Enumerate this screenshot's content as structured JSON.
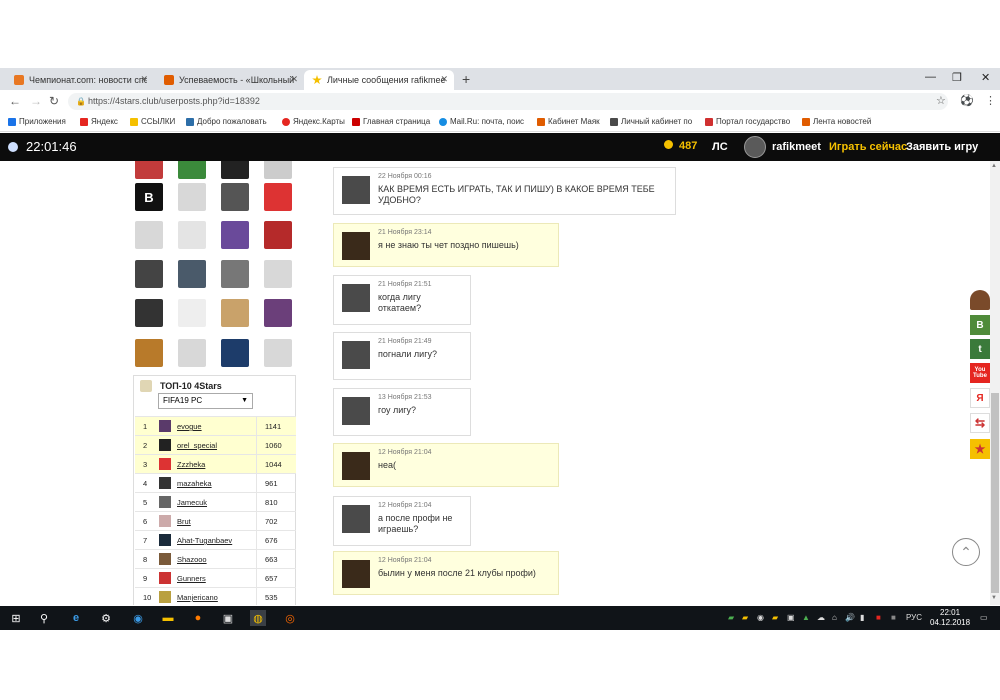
{
  "browser": {
    "tabs": [
      {
        "title": "Чемпионат.com: новости спорт",
        "favicon_color": "#e87722"
      },
      {
        "title": "Успеваемость - «Школьный по",
        "favicon_color": "#e05c00"
      },
      {
        "title": "Личные сообщения rafikmeet. -",
        "favicon_color": "#f5c000"
      }
    ],
    "new_tab": "+",
    "url": "https://4stars.club/userposts.php?id=18392",
    "bookmarks": [
      {
        "label": "Приложения",
        "color": "#1a73e8"
      },
      {
        "label": "Яндекс",
        "color": "#e52620"
      },
      {
        "label": "ССЫЛКИ",
        "color": "#f5c000"
      },
      {
        "label": "Добро пожаловать",
        "color": "#2d6ea8"
      },
      {
        "label": "Яндекс.Карты",
        "color": "#e52620"
      },
      {
        "label": "Главная страница",
        "color": "#c00"
      },
      {
        "label": "Mail.Ru: почта, поис",
        "color": "#168de2"
      },
      {
        "label": "Кабинет Маяк",
        "color": "#e05c00"
      },
      {
        "label": "Личный кабинет по",
        "color": "#4a4a4a"
      },
      {
        "label": "Портал государство",
        "color": "#d03030"
      },
      {
        "label": "Лента новостей",
        "color": "#e05c00"
      }
    ]
  },
  "site": {
    "clock": "22:01:46",
    "coins": "487",
    "ls": "ЛС",
    "username": "rafikmeet",
    "play_now": "Играть сейчас",
    "declare_game": "Заявить игру"
  },
  "top10": {
    "title": "ТОП-10 4Stars",
    "selected": "FIFA19 PC",
    "rows": [
      {
        "rank": "1",
        "name": "evogue",
        "score": "1141"
      },
      {
        "rank": "2",
        "name": "orel_special",
        "score": "1060"
      },
      {
        "rank": "3",
        "name": "Zzzheka",
        "score": "1044"
      },
      {
        "rank": "4",
        "name": "mazaheka",
        "score": "961"
      },
      {
        "rank": "5",
        "name": "Jamecuk",
        "score": "810"
      },
      {
        "rank": "6",
        "name": "Brut",
        "score": "702"
      },
      {
        "rank": "7",
        "name": "Ahat-Tuganbaev",
        "score": "676"
      },
      {
        "rank": "8",
        "name": "Shazooo",
        "score": "663"
      },
      {
        "rank": "9",
        "name": "Gunners",
        "score": "657"
      },
      {
        "rank": "10",
        "name": "Manjericano",
        "score": "535"
      }
    ]
  },
  "messages": [
    {
      "date": "22 Ноября 00:16",
      "text": "КАК ВРЕМЯ ЕСТЬ ИГРАТЬ, ТАК И ПИШУ) В КАКОЕ ВРЕМЯ ТЕБЕ\nУДОБНО?",
      "mine": false
    },
    {
      "date": "21 Ноября 23:14",
      "text": "я не знаю ты чет поздно пишешь)",
      "mine": true
    },
    {
      "date": "21 Ноября 21:51",
      "text": "когда лигу\nоткатаем?",
      "mine": false
    },
    {
      "date": "21 Ноября 21:49",
      "text": "погнали лигу?",
      "mine": false
    },
    {
      "date": "13 Ноября 21:53",
      "text": "гоу лигу?",
      "mine": false
    },
    {
      "date": "12 Ноября 21:04",
      "text": "неа(",
      "mine": true
    },
    {
      "date": "12 Ноября 21:04",
      "text": "а после профи не\nиграешь?",
      "mine": false
    },
    {
      "date": "12 Ноября 21:04",
      "text": "былин у меня после 21 клубы профи)",
      "mine": true
    }
  ],
  "social": [
    "В",
    "t",
    "You Tube",
    "Я"
  ],
  "taskbar": {
    "lang": "РУС",
    "time": "22:01",
    "date": "04.12.2018"
  }
}
